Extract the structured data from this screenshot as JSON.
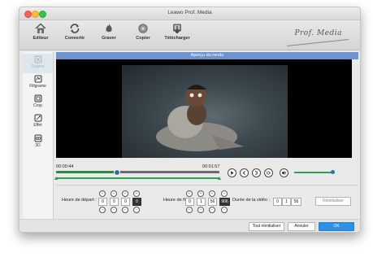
{
  "window": {
    "title": "Leawo Prof. Media"
  },
  "toolbar": {
    "items": [
      {
        "label": "Editeur",
        "icon": "home-icon"
      },
      {
        "label": "Convertir",
        "icon": "convert-icon"
      },
      {
        "label": "Graver",
        "icon": "burn-icon"
      },
      {
        "label": "Copier",
        "icon": "disc-icon"
      },
      {
        "label": "Télécharger",
        "icon": "download-icon"
      }
    ],
    "brand": "Prof. Media"
  },
  "sidebar": {
    "items": [
      {
        "label": "Rogner",
        "icon": "trim-icon",
        "active": true
      },
      {
        "label": "Filigrame",
        "icon": "watermark-icon"
      },
      {
        "label": "Crop",
        "icon": "crop-icon"
      },
      {
        "label": "Effet",
        "icon": "effect-icon"
      },
      {
        "label": "3D",
        "icon": "3d-icon"
      }
    ]
  },
  "preview": {
    "title": "Aperçu du rendu"
  },
  "player": {
    "current_time": "00:00:44",
    "total_time": "00:01:57",
    "progress": 0.37,
    "trim_start": 0.0,
    "trim_end": 1.0,
    "controls": [
      "play-icon",
      "previous-icon",
      "stop-icon",
      "next-icon",
      "volume-icon"
    ],
    "volume": 1.0,
    "accent_color": "#2ea04f"
  },
  "trim": {
    "start_label": "Heure de départ :",
    "start": [
      "0",
      "0",
      "0",
      "0"
    ],
    "end_label": "Heure de fin :",
    "end": [
      "0",
      "1",
      "56",
      "906"
    ],
    "duration_label": "Durée de la vidéo :",
    "duration": [
      "0",
      "1",
      "56"
    ],
    "reset_label": "Réinitialiser"
  },
  "footer": {
    "reset_all": "Tout réinitialiser",
    "cancel": "Annuler",
    "ok": "OK"
  }
}
